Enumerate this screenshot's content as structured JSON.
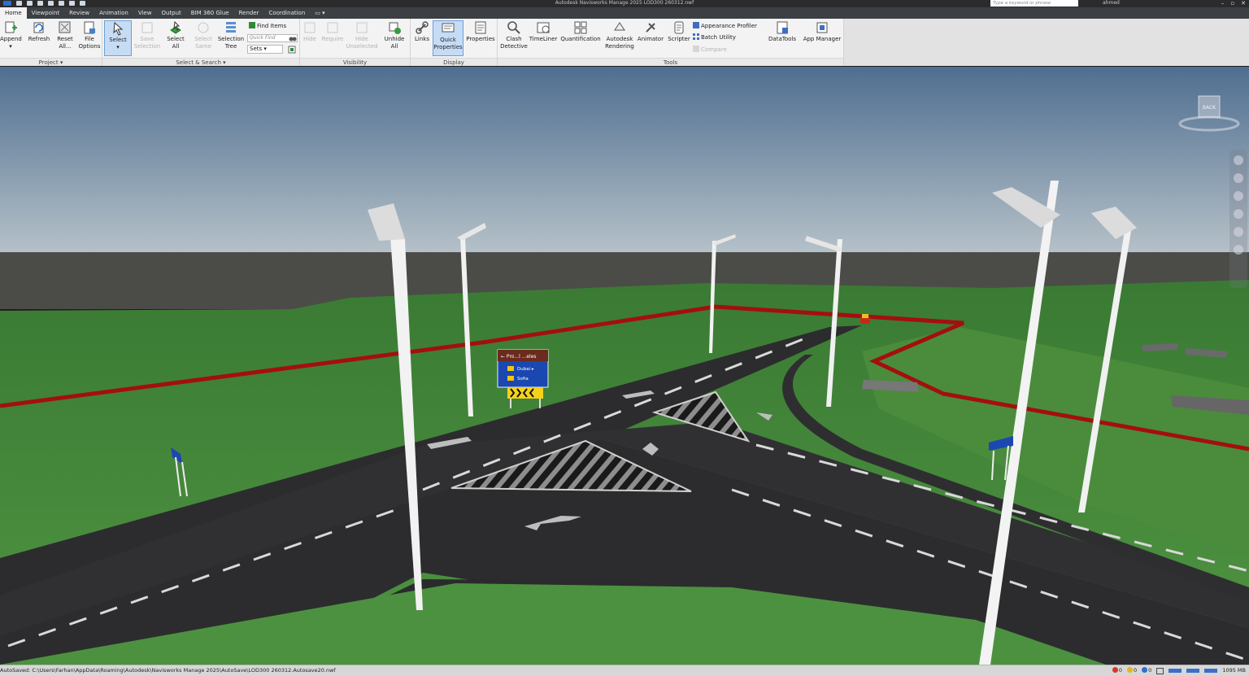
{
  "window": {
    "title": "Autodesk Navisworks Manage 2025   LOD300 260312.nwf",
    "search_placeholder": "Type a keyword or phrase",
    "user": "ahmed"
  },
  "tabs": [
    {
      "label": "Home",
      "active": true
    },
    {
      "label": "Viewpoint"
    },
    {
      "label": "Review"
    },
    {
      "label": "Animation"
    },
    {
      "label": "View"
    },
    {
      "label": "Output"
    },
    {
      "label": "BIM 360 Glue"
    },
    {
      "label": "Render"
    },
    {
      "label": "Coordination"
    },
    {
      "label": "▭ ▾"
    }
  ],
  "ribbon": {
    "project": {
      "title": "Project ▾",
      "append": [
        "Append",
        "▾"
      ],
      "refresh": [
        "Refresh",
        ""
      ],
      "reset": [
        "Reset",
        "All..."
      ],
      "file_options": [
        "File",
        "Options"
      ]
    },
    "select_search": {
      "title": "Select & Search ▾",
      "select": [
        "Select",
        "▾"
      ],
      "save_selection": [
        "Save",
        "Selection"
      ],
      "select_all": [
        "Select",
        "All"
      ],
      "select_same": [
        "Select",
        "Same"
      ],
      "selection_tree": [
        "Selection",
        "Tree"
      ],
      "find_items": "Find Items",
      "quick_find_placeholder": "Quick Find",
      "sets": "Sets"
    },
    "visibility": {
      "title": "Visibility",
      "hide": [
        "Hide",
        ""
      ],
      "require": [
        "Require",
        ""
      ],
      "hide_unselected": [
        "Hide",
        "Unselected"
      ],
      "unhide_all": [
        "Unhide",
        "All"
      ]
    },
    "display": {
      "title": "Display",
      "links": [
        "Links",
        ""
      ],
      "quick_properties": [
        "Quick",
        "Properties"
      ],
      "properties": [
        "Properties",
        ""
      ]
    },
    "tools": {
      "title": "Tools",
      "clash_detective": [
        "Clash",
        "Detective"
      ],
      "timeliner": [
        "TimeLiner",
        ""
      ],
      "quantification": [
        "Quantification",
        ""
      ],
      "autodesk_rendering": [
        "Autodesk",
        "Rendering"
      ],
      "animator": [
        "Animator",
        ""
      ],
      "scripter": [
        "Scripter",
        ""
      ],
      "appearance_profiler": "Appearance Profiler",
      "batch_utility": "Batch Utility",
      "compare": "Compare",
      "datatools": [
        "DataTools",
        ""
      ],
      "app_manager": [
        "App Manager",
        ""
      ]
    }
  },
  "viewcube": {
    "face": "BACK"
  },
  "scene": {
    "sign_main": {
      "header": "← Pro...l   ...eles",
      "row1": "Dubai ▸",
      "row2": "Sofia"
    }
  },
  "status": {
    "path": "AutoSaved: C:\\Users\\Farhan\\AppData\\Roaming\\Autodesk\\Navisworks Manage 2025\\AutoSave\\LOD300 260312.Autosave20.nwf",
    "errors": "0",
    "warnings": "0",
    "info": "0",
    "memory": "1095 MB"
  }
}
